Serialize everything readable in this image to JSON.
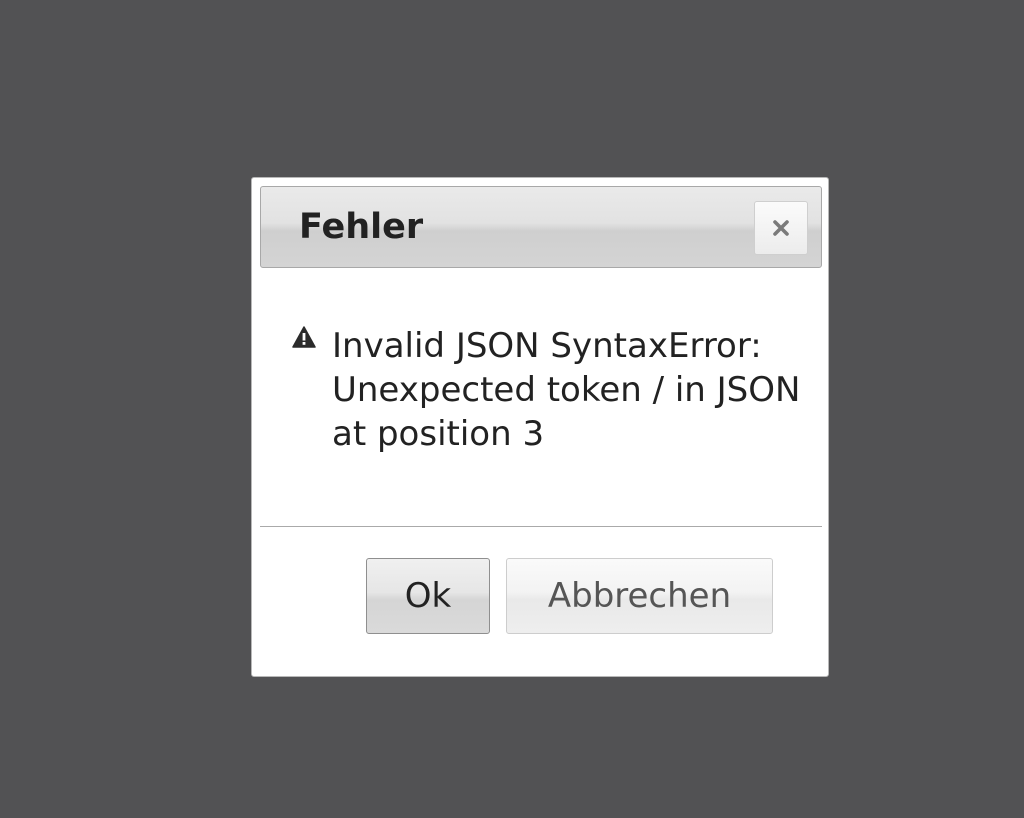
{
  "dialog": {
    "title": "Fehler",
    "close_icon": "close-icon",
    "message_icon": "alert-icon",
    "message": "Invalid JSON SyntaxError: Unexpected token / in JSON at position 3",
    "ok_label": "Ok",
    "cancel_label": "Abbrechen"
  },
  "colors": {
    "overlay": "#525254",
    "dialog_background": "#ffffff",
    "text": "#222222",
    "secondary_text": "#555555"
  }
}
